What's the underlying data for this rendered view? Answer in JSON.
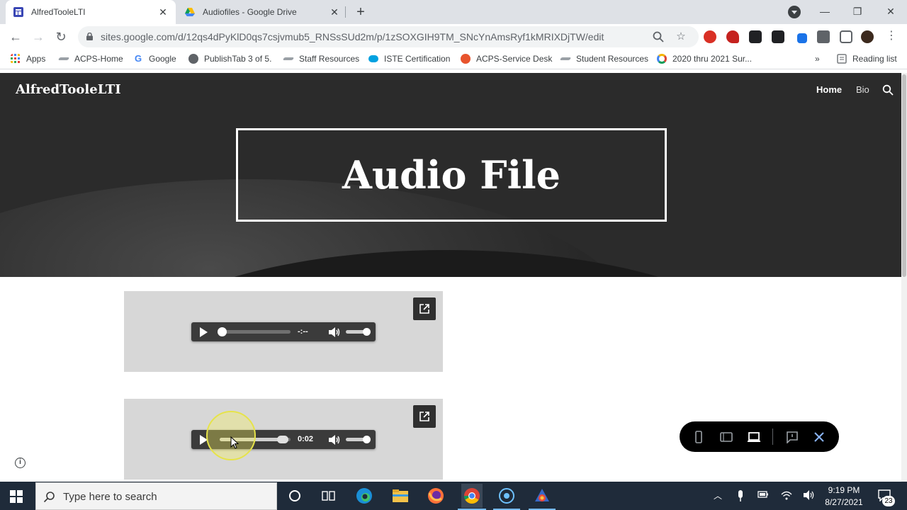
{
  "browser": {
    "tabs": [
      {
        "title": "AlfredTooleLTI",
        "close": "✕"
      },
      {
        "title": "Audiofiles - Google Drive",
        "close": "✕"
      }
    ],
    "new_tab": "+",
    "window_controls": {
      "minimize": "—",
      "restore": "❐",
      "close": "✕"
    },
    "url": "sites.google.com/d/12qs4dPyKlD0qs7csjvmub5_RNSsSUd2m/p/1zSOXGIH9TM_SNcYnAmsRyf1kMRIXDjTW/edit",
    "bookmarks": [
      {
        "label": "Apps",
        "icon": "apps-grid-icon"
      },
      {
        "label": "ACPS-Home",
        "icon": "acps-home-icon"
      },
      {
        "label": "Google",
        "icon": "google-icon"
      },
      {
        "label": "PublishTab 3 of 5.",
        "icon": "globe-icon"
      },
      {
        "label": "Staff Resources",
        "icon": "staff-resources-icon"
      },
      {
        "label": "ISTE Certification",
        "icon": "salesforce-cloud-icon"
      },
      {
        "label": "ACPS-Service Desk",
        "icon": "service-desk-icon"
      },
      {
        "label": "Student Resources",
        "icon": "student-resources-icon"
      },
      {
        "label": "2020  thru 2021 Sur...",
        "icon": "survey-ring-icon"
      }
    ],
    "bookmarks_overflow": "»",
    "reading_list": "Reading list"
  },
  "site": {
    "name": "AlfredTooleLTI",
    "nav": {
      "home": "Home",
      "bio": "Bio"
    },
    "page_title": "Audio File",
    "players": [
      {
        "time": "-:--",
        "progress": 0.0
      },
      {
        "time": "0:02",
        "progress": 0.9
      }
    ],
    "preview_toolbar": [
      "phone-preview-icon",
      "tablet-preview-icon",
      "laptop-preview-icon",
      "feedback-icon",
      "close-icon"
    ]
  },
  "taskbar": {
    "search_placeholder": "Type here to search",
    "time": "9:19 PM",
    "date": "8/27/2021",
    "notification_count": "23"
  },
  "colors": {
    "hero_bg": "#2b2b2b",
    "embed_bg": "#d7d7d7",
    "player_bg": "#3b3b3b",
    "taskbar_bg": "#1f2b3a",
    "cursor_highlight": "#f5f05a"
  }
}
